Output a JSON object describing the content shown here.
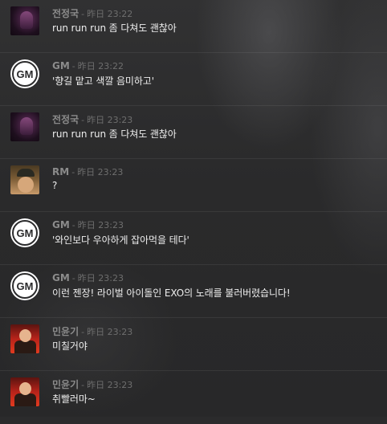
{
  "messages": [
    {
      "author": "전정국",
      "sep": "-",
      "time": "昨日 23:22",
      "text": "run run run 좀 다쳐도 괜찮아",
      "avatar": "jk"
    },
    {
      "author": "GM",
      "sep": "-",
      "time": "昨日 23:22",
      "text": "'향길 맡고 색깔 음미하고'",
      "avatar": "gm"
    },
    {
      "author": "전정국",
      "sep": "-",
      "time": "昨日 23:23",
      "text": "run run run 좀 다쳐도 괜찮아",
      "avatar": "jk"
    },
    {
      "author": "RM",
      "sep": "-",
      "time": "昨日 23:23",
      "text": "?",
      "avatar": "rm"
    },
    {
      "author": "GM",
      "sep": "-",
      "time": "昨日 23:23",
      "text": "'와인보다 우아하게 잡아먹을 테다'",
      "avatar": "gm"
    },
    {
      "author": "GM",
      "sep": "-",
      "time": "昨日 23:23",
      "text": "이런 젠장! 라이벌 아이돌인 EXO의 노래를 불러버렸습니다!",
      "avatar": "gm"
    },
    {
      "author": "민윤기",
      "sep": "-",
      "time": "昨日 23:23",
      "text": "미칠거야",
      "avatar": "yg"
    },
    {
      "author": "민윤기",
      "sep": "-",
      "time": "昨日 23:23",
      "text": "취빨러마~",
      "avatar": "yg"
    }
  ],
  "gm_badge": "GM",
  "colors": {
    "background": "#2b2b2c",
    "author": "#8b8b8b",
    "timestamp": "#6e6e6e",
    "message_text": "#eeeeee"
  }
}
